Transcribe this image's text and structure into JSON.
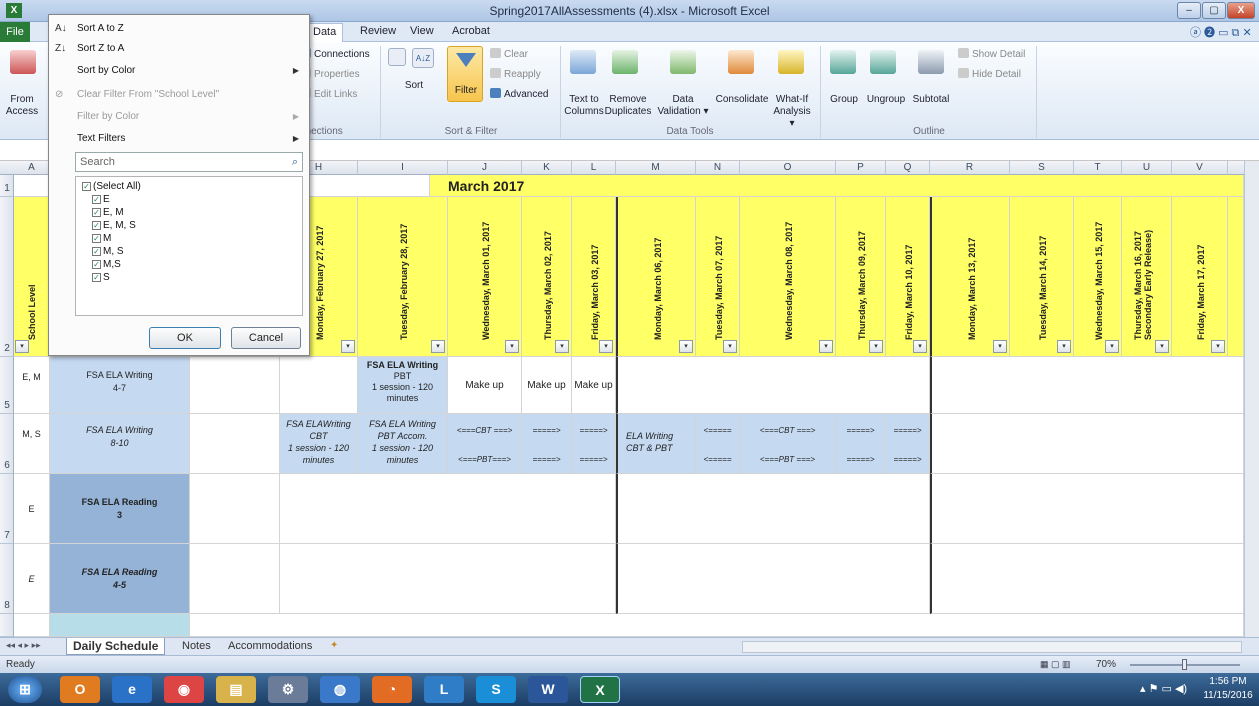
{
  "window": {
    "title": "Spring2017AllAssessments (4).xlsx - Microsoft Excel",
    "min": "–",
    "max": "▢",
    "close": "X"
  },
  "menu_tabs": {
    "file": "File",
    "data": "Data",
    "review": "Review",
    "view": "View",
    "acrobat": "Acrobat"
  },
  "ribbon": {
    "from_access": "From",
    "from_access2": "Access",
    "connections": "Connections",
    "properties": "Properties",
    "edit_links": "Edit Links",
    "connections_group": "nnections",
    "sort_az": "A↓Z",
    "sort": "Sort",
    "filter": "Filter",
    "clear": "Clear",
    "reapply": "Reapply",
    "advanced": "Advanced",
    "sort_filter_group": "Sort & Filter",
    "text_to_columns": "Text to",
    "text_to_columns2": "Columns",
    "remove_duplicates": "Remove",
    "remove_duplicates2": "Duplicates",
    "data_validation": "Data",
    "data_validation2": "Validation ▾",
    "consolidate": "Consolidate",
    "what_if": "What-If",
    "what_if2": "Analysis ▾",
    "data_tools_group": "Data Tools",
    "group": "Group",
    "ungroup": "Ungroup",
    "subtotal": "Subtotal",
    "show_detail": "Show Detail",
    "hide_detail": "Hide Detail",
    "outline_group": "Outline"
  },
  "filter_menu": {
    "sort_a_z": "Sort A to Z",
    "sort_z_a": "Sort Z to A",
    "sort_by_color": "Sort by Color",
    "clear_filter": "Clear Filter From \"School Level\"",
    "filter_by_color": "Filter by Color",
    "text_filters": "Text Filters",
    "search_placeholder": "Search",
    "items": [
      "(Select All)",
      "E",
      "E, M",
      "E, M, S",
      "M",
      "M, S",
      "M,S",
      "S"
    ],
    "ok": "OK",
    "cancel": "Cancel"
  },
  "columns": [
    "A",
    "H",
    "I",
    "J",
    "K",
    "L",
    "M",
    "N",
    "O",
    "P",
    "Q",
    "R",
    "S",
    "T",
    "U",
    "V"
  ],
  "rows": [
    "1",
    "2",
    "5",
    "6",
    "7",
    "8"
  ],
  "sheet": {
    "title": "March 2017",
    "school_level_header": "School Level",
    "dates": [
      "Monday, February 27, 2017",
      "Tuesday, February 28, 2017",
      "Wednesday, March 01, 2017",
      "Thursday, March 02, 2017",
      "Friday, March 03, 2017",
      "Monday, March 06, 2017",
      "Tuesday, March 07, 2017",
      "Wednesday, March 08, 2017",
      "Thursday, March 09, 2017",
      "Friday, March 10, 2017",
      "Monday, March 13, 2017",
      "Tuesday, March 14, 2017",
      "Wednesday, March 15, 2017",
      "Thursday, March 16, 2017",
      "Secondary Early Release)",
      "Friday, March 17, 2017"
    ],
    "row5": {
      "level": "E, M",
      "test": "FSA ELA Writing",
      "grades": "4-7",
      "i_line1": "FSA ELA Writing",
      "i_line2": "PBT",
      "i_line3": "1 session - 120",
      "i_line4": "minutes",
      "j": "Make up",
      "k": "Make up",
      "l": "Make up"
    },
    "row6": {
      "level": "M, S",
      "test": "FSA ELA Writing",
      "grades": "8-10",
      "h_line1": "FSA ELAWriting",
      "h_line2": "CBT",
      "h_line3": "1 session - 120",
      "h_line4": "minutes",
      "i_line1": "FSA ELA Writing",
      "i_line2": "PBT Accom.",
      "i_line3": "1 session - 120",
      "i_line4": "minutes",
      "j_top": "<===CBT ===>",
      "j_bot": "<===PBT===>",
      "arrow": "=====>",
      "m_line1": "ELA Writing",
      "m_line2": "CBT & PBT",
      "arrow_l": "<=====",
      "o_top": "<===CBT ===>",
      "o_bot": "<===PBT ===>"
    },
    "row7": {
      "level": "E",
      "test": "FSA ELA Reading",
      "grades": "3"
    },
    "row8": {
      "level": "E",
      "test": "FSA ELA Reading",
      "grades": "4-5"
    }
  },
  "sheet_tabs": [
    "Daily Schedule",
    "Notes",
    "Accommodations"
  ],
  "status": {
    "ready": "Ready",
    "zoom": "70%"
  },
  "taskbar": {
    "time": "1:56 PM",
    "date": "11/15/2016"
  },
  "colors": {
    "yellow": "#ffff66",
    "light_blue": "#c5d9f1",
    "mid_blue": "#95b3d7",
    "excel_green": "#2a7a38"
  }
}
